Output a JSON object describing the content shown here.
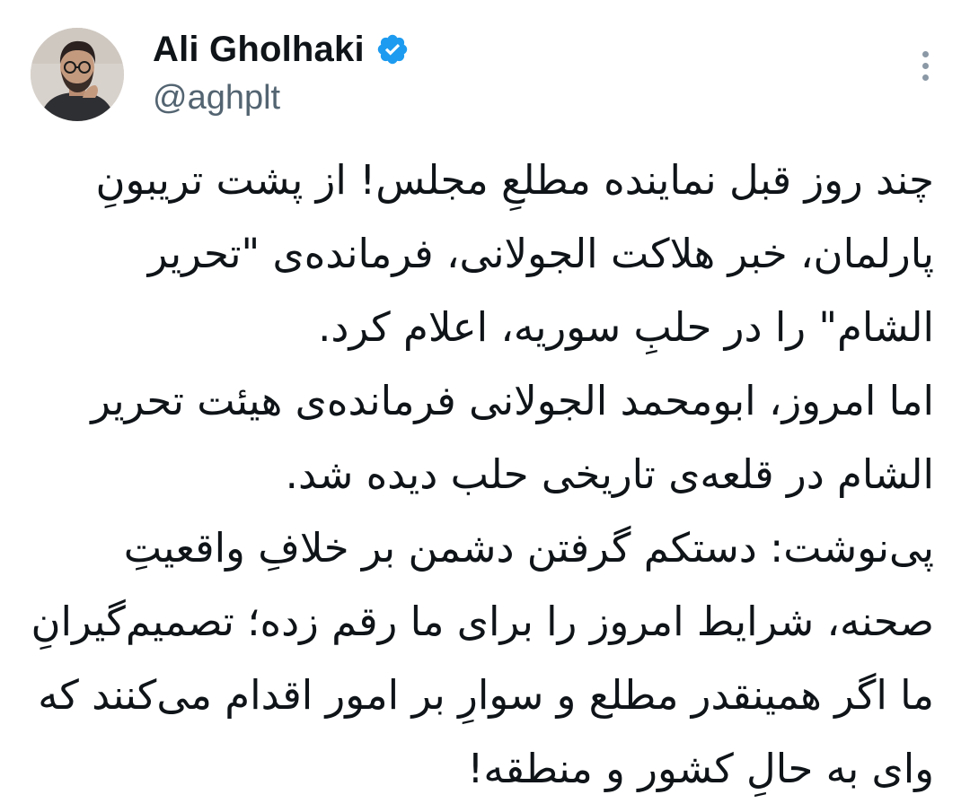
{
  "author": {
    "display_name": "Ali Gholhaki",
    "handle": "@aghplt",
    "verified": true,
    "verified_color": "#1d9bf0",
    "avatar_icon": "avatar-photo"
  },
  "more_icon": "more-vertical-icon",
  "tweet": {
    "lines": [
      "چند روز قبل نماینده مطلعِ مجلس! از پشت تریبونِ",
      "پارلمان، خبر هلاکت الجولانی، فرمانده‌ی \"تحریر",
      "الشام\" را در حلبِ سوریه، اعلام کرد.",
      "اما امروز، ابومحمد الجولانی فرمانده‌ی هیئت تحریر",
      "الشام در قلعه‌ی تاریخی حلب دیده شد.",
      "پی‌نوشت: دستکم گرفتن دشمن بر خلافِ واقعیتِ",
      "صحنه، شرایط امروز را برای ما رقم زده؛ تصمیم‌گیرانِ",
      "ما اگر همینقدر مطلع و سوارِ بر امور اقدام می‌کنند که",
      "وای به حالِ کشور و منطقه!"
    ]
  },
  "colors": {
    "text": "#0f1419",
    "secondary": "#536471",
    "background": "#ffffff"
  }
}
